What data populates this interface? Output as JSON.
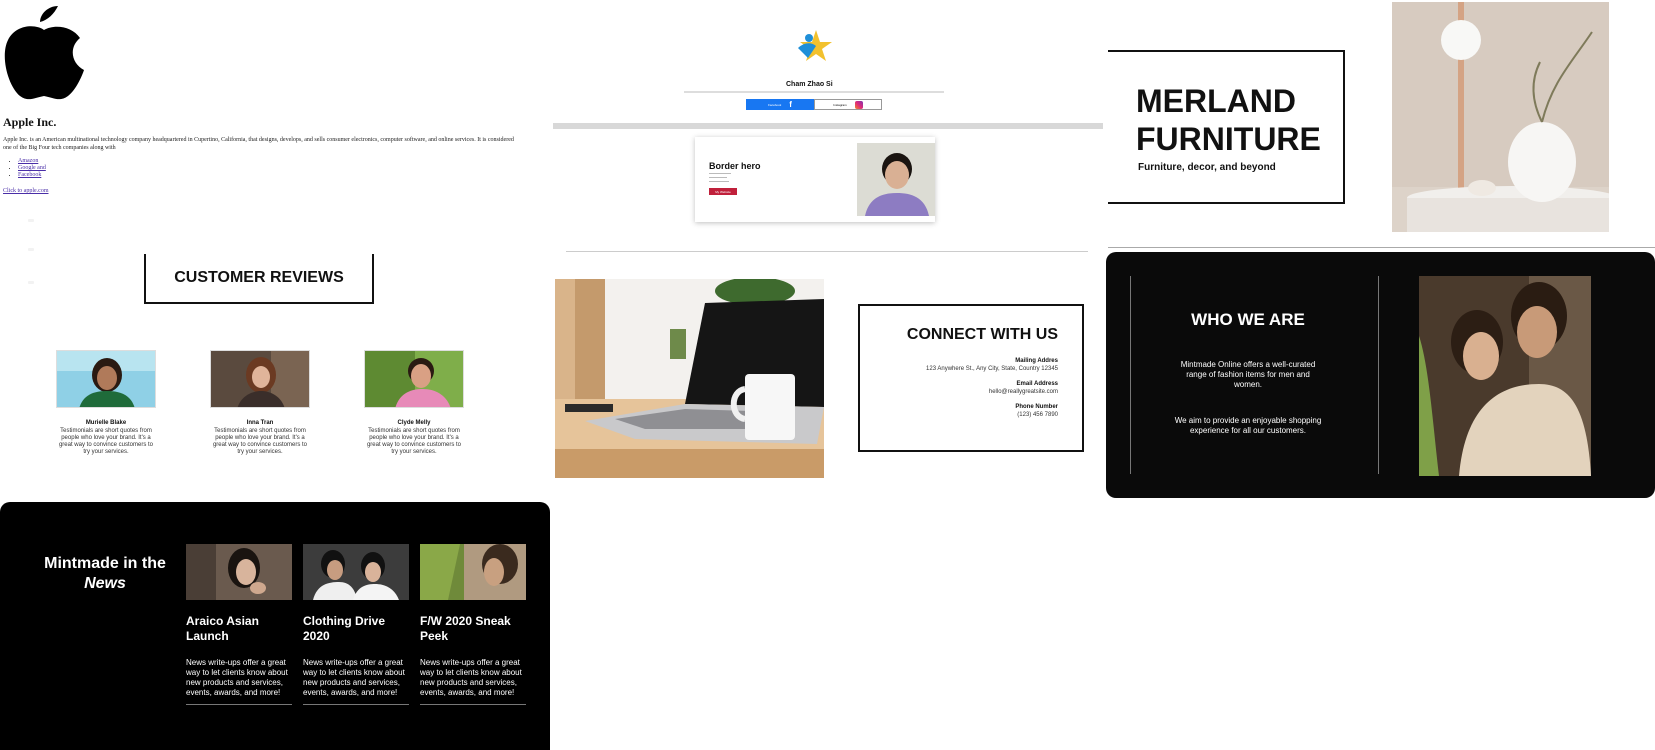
{
  "apple": {
    "title": "Apple Inc.",
    "description": "Apple Inc. is an American multinational technology company headquartered in Cupertino, California, that designs, develops, and sells consumer electronics, computer software, and online services. It is considered one of the Big Four tech companies along with",
    "links": [
      "Amazon",
      "Google and",
      "Facebook"
    ],
    "site_link": "Click to apple.com"
  },
  "reviews": {
    "heading": "CUSTOMER REVIEWS",
    "items": [
      {
        "name": "Murielle Blake",
        "text": "Testimonials are short quotes from people who love your brand. It's a great way to convince customers to try your services."
      },
      {
        "name": "Inna Tran",
        "text": "Testimonials are short quotes from people who love your brand. It's a great way to convince customers to try your services."
      },
      {
        "name": "Clyde Melly",
        "text": "Testimonials are short quotes from people who love your brand. It's a great way to convince customers to try your services."
      }
    ]
  },
  "news": {
    "title_line1": "Mintmade in the",
    "title_line2": "News",
    "items": [
      {
        "title": "Araico Asian Launch",
        "body": "News write-ups offer a great way to let clients know about new products and services, events, awards, and more!"
      },
      {
        "title": "Clothing Drive 2020",
        "body": "News write-ups offer a great way to let clients know about new products and services, events, awards, and more!"
      },
      {
        "title": "F/W 2020 Sneak Peek",
        "body": "News write-ups offer a great way to let clients know about new products and services, events, awards, and more!"
      }
    ]
  },
  "profile": {
    "name": "Cham Zhao Si",
    "facebook_label": "Facebook",
    "instagram_label": "Instagram"
  },
  "hero": {
    "title": "Border hero",
    "button": "My Website"
  },
  "connect": {
    "heading": "CONNECT WITH US",
    "mailing_label": "Mailing Addres",
    "mailing_value": "123 Anywhere St., Any City, State, Country 12345",
    "email_label": "Email Address",
    "email_value": "hello@reallygreatsite.com",
    "phone_label": "Phone Number",
    "phone_value": "(123) 456 7890"
  },
  "merland": {
    "title_line1": "MERLAND",
    "title_line2": "FURNITURE",
    "subtitle": "Furniture, decor, and beyond"
  },
  "who": {
    "heading": "WHO WE ARE",
    "para1": "Mintmade Online offers a well-curated range of fashion items for men and women.",
    "para2": "We aim to provide an enjoyable shopping experience for all our customers."
  },
  "colors": {
    "facebook": "#1877f2",
    "hero_button": "#c0203b",
    "dark_panel": "#0a0a0a"
  }
}
